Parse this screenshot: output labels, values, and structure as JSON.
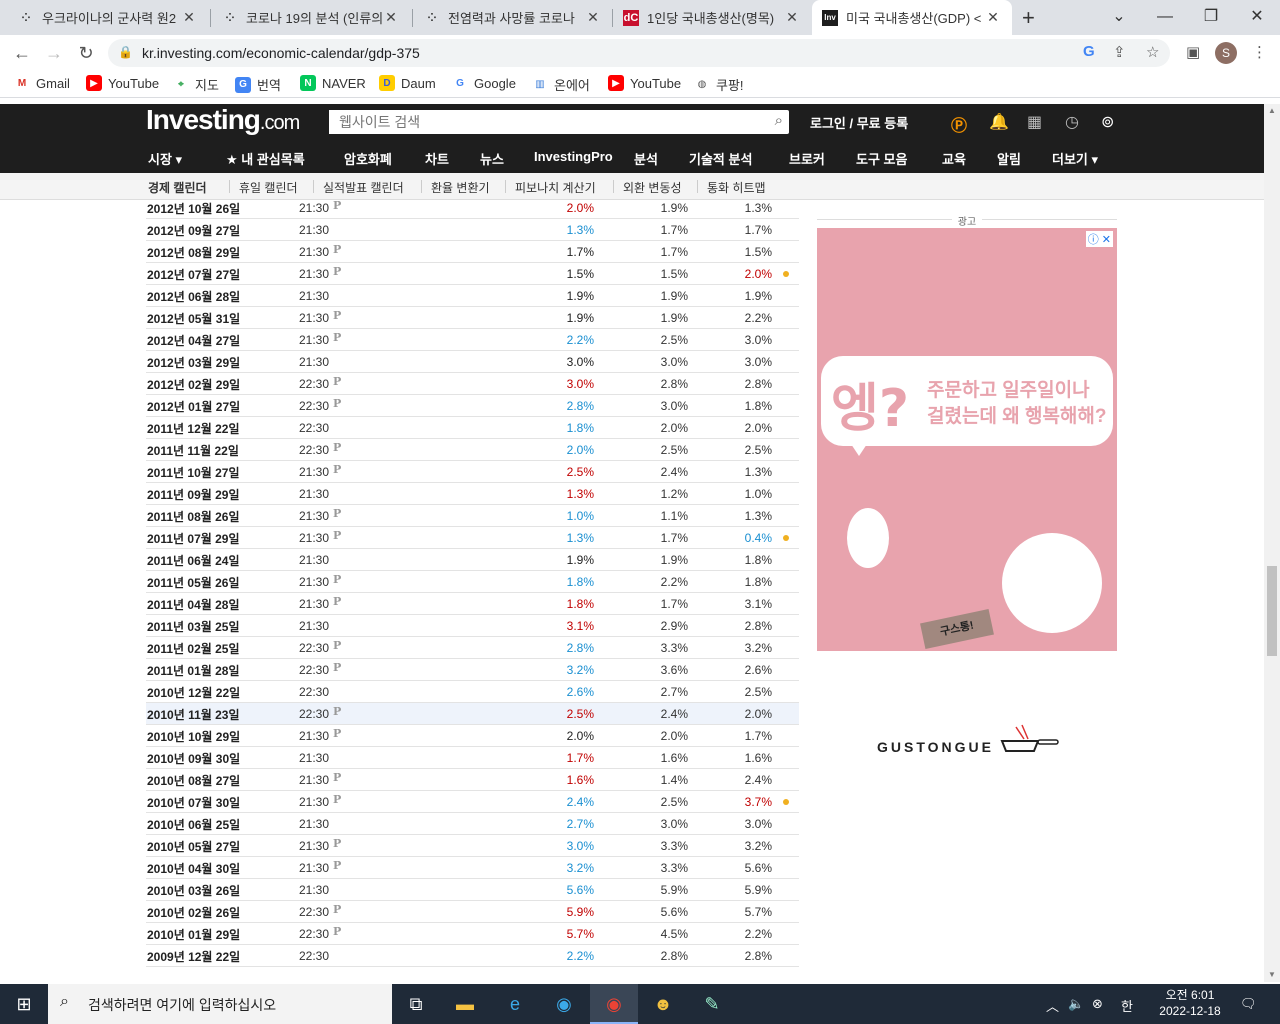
{
  "browser": {
    "tabs": [
      {
        "title": "우크라이나의 군사력 원2",
        "icon": "dots-icon"
      },
      {
        "title": "코로나 19의 분석 (인류의",
        "icon": "dots-icon"
      },
      {
        "title": "전염력과 사망률 코로나",
        "icon": "dots-icon"
      },
      {
        "title": "1인당 국내총생산(명목)",
        "icon": "dc-icon",
        "icon_text": "dC"
      },
      {
        "title": "미국 국내총생산(GDP) <",
        "icon": "inv-icon",
        "icon_text": "Inv",
        "active": true
      }
    ],
    "url": "kr.investing.com/economic-calendar/gdp-375",
    "profile_initial": "S"
  },
  "bookmarks": [
    {
      "label": "Gmail",
      "icon": "gmail-icon"
    },
    {
      "label": "YouTube",
      "icon": "youtube-icon"
    },
    {
      "label": "지도",
      "icon": "maps-icon"
    },
    {
      "label": "번역",
      "icon": "translate-icon"
    },
    {
      "label": "NAVER",
      "icon": "naver-icon",
      "icon_text": "N"
    },
    {
      "label": "Daum",
      "icon": "daum-icon",
      "icon_text": "D"
    },
    {
      "label": "Google",
      "icon": "google-icon",
      "icon_text": "G"
    },
    {
      "label": "온에어",
      "icon": "onair-icon"
    },
    {
      "label": "YouTube",
      "icon": "youtube-icon"
    },
    {
      "label": "쿠팡!",
      "icon": "globe-icon"
    }
  ],
  "site": {
    "logo": "Investing",
    "logo_domain": ".com",
    "search_placeholder": "웹사이트 검색",
    "login": "로그인 / 무료 등록",
    "nav": [
      "시장 ▾",
      "★ 내 관심목록",
      "암호화폐",
      "차트",
      "뉴스",
      "InvestingPro",
      "분석",
      "기술적 분석",
      "브로커",
      "도구 모음",
      "교육",
      "알림",
      "더보기 ▾"
    ],
    "subnav": [
      "경제 캘린더",
      "휴일 캘린더",
      "실적발표 캘린더",
      "환율 변환기",
      "피보나치 계산기",
      "외환 변동성",
      "통화 히트맵"
    ]
  },
  "colors": {
    "up": "#0ea600",
    "down": "#c00",
    "neutral": "#222",
    "blue": "#1a8fd1",
    "red": "#c00000",
    "accent": "#f0b020"
  },
  "table": {
    "rows": [
      {
        "date": "2012년 10월 26일",
        "time": "21:30",
        "p": true,
        "actual": "2.0%",
        "actual_color": "red",
        "forecast": "1.9%",
        "previous": "1.3%"
      },
      {
        "date": "2012년 09월 27일",
        "time": "21:30",
        "p": false,
        "actual": "1.3%",
        "actual_color": "blue",
        "forecast": "1.7%",
        "previous": "1.7%"
      },
      {
        "date": "2012년 08월 29일",
        "time": "21:30",
        "p": true,
        "actual": "1.7%",
        "actual_color": "neutral",
        "forecast": "1.7%",
        "previous": "1.5%"
      },
      {
        "date": "2012년 07월 27일",
        "time": "21:30",
        "p": true,
        "actual": "1.5%",
        "actual_color": "neutral",
        "forecast": "1.5%",
        "previous": "2.0%",
        "previous_color": "red",
        "dot": true
      },
      {
        "date": "2012년 06월 28일",
        "time": "21:30",
        "p": false,
        "actual": "1.9%",
        "actual_color": "neutral",
        "forecast": "1.9%",
        "previous": "1.9%"
      },
      {
        "date": "2012년 05월 31일",
        "time": "21:30",
        "p": true,
        "actual": "1.9%",
        "actual_color": "neutral",
        "forecast": "1.9%",
        "previous": "2.2%"
      },
      {
        "date": "2012년 04월 27일",
        "time": "21:30",
        "p": true,
        "actual": "2.2%",
        "actual_color": "blue",
        "forecast": "2.5%",
        "previous": "3.0%"
      },
      {
        "date": "2012년 03월 29일",
        "time": "21:30",
        "p": false,
        "actual": "3.0%",
        "actual_color": "neutral",
        "forecast": "3.0%",
        "previous": "3.0%"
      },
      {
        "date": "2012년 02월 29일",
        "time": "22:30",
        "p": true,
        "actual": "3.0%",
        "actual_color": "red",
        "forecast": "2.8%",
        "previous": "2.8%"
      },
      {
        "date": "2012년 01월 27일",
        "time": "22:30",
        "p": true,
        "actual": "2.8%",
        "actual_color": "blue",
        "forecast": "3.0%",
        "previous": "1.8%"
      },
      {
        "date": "2011년 12월 22일",
        "time": "22:30",
        "p": false,
        "actual": "1.8%",
        "actual_color": "blue",
        "forecast": "2.0%",
        "previous": "2.0%"
      },
      {
        "date": "2011년 11월 22일",
        "time": "22:30",
        "p": true,
        "actual": "2.0%",
        "actual_color": "blue",
        "forecast": "2.5%",
        "previous": "2.5%"
      },
      {
        "date": "2011년 10월 27일",
        "time": "21:30",
        "p": true,
        "actual": "2.5%",
        "actual_color": "red",
        "forecast": "2.4%",
        "previous": "1.3%"
      },
      {
        "date": "2011년 09월 29일",
        "time": "21:30",
        "p": false,
        "actual": "1.3%",
        "actual_color": "red",
        "forecast": "1.2%",
        "previous": "1.0%"
      },
      {
        "date": "2011년 08월 26일",
        "time": "21:30",
        "p": true,
        "actual": "1.0%",
        "actual_color": "blue",
        "forecast": "1.1%",
        "previous": "1.3%"
      },
      {
        "date": "2011년 07월 29일",
        "time": "21:30",
        "p": true,
        "actual": "1.3%",
        "actual_color": "blue",
        "forecast": "1.7%",
        "previous": "0.4%",
        "previous_color": "blue",
        "dot": true
      },
      {
        "date": "2011년 06월 24일",
        "time": "21:30",
        "p": false,
        "actual": "1.9%",
        "actual_color": "neutral",
        "forecast": "1.9%",
        "previous": "1.8%"
      },
      {
        "date": "2011년 05월 26일",
        "time": "21:30",
        "p": true,
        "actual": "1.8%",
        "actual_color": "blue",
        "forecast": "2.2%",
        "previous": "1.8%"
      },
      {
        "date": "2011년 04월 28일",
        "time": "21:30",
        "p": true,
        "actual": "1.8%",
        "actual_color": "red",
        "forecast": "1.7%",
        "previous": "3.1%"
      },
      {
        "date": "2011년 03월 25일",
        "time": "21:30",
        "p": false,
        "actual": "3.1%",
        "actual_color": "red",
        "forecast": "2.9%",
        "previous": "2.8%"
      },
      {
        "date": "2011년 02월 25일",
        "time": "22:30",
        "p": true,
        "actual": "2.8%",
        "actual_color": "blue",
        "forecast": "3.3%",
        "previous": "3.2%"
      },
      {
        "date": "2011년 01월 28일",
        "time": "22:30",
        "p": true,
        "actual": "3.2%",
        "actual_color": "blue",
        "forecast": "3.6%",
        "previous": "2.6%"
      },
      {
        "date": "2010년 12월 22일",
        "time": "22:30",
        "p": false,
        "actual": "2.6%",
        "actual_color": "blue",
        "forecast": "2.7%",
        "previous": "2.5%"
      },
      {
        "date": "2010년 11월 23일",
        "time": "22:30",
        "p": true,
        "actual": "2.5%",
        "actual_color": "red",
        "forecast": "2.4%",
        "previous": "2.0%",
        "highlight": true
      },
      {
        "date": "2010년 10월 29일",
        "time": "21:30",
        "p": true,
        "actual": "2.0%",
        "actual_color": "neutral",
        "forecast": "2.0%",
        "previous": "1.7%"
      },
      {
        "date": "2010년 09월 30일",
        "time": "21:30",
        "p": false,
        "actual": "1.7%",
        "actual_color": "red",
        "forecast": "1.6%",
        "previous": "1.6%"
      },
      {
        "date": "2010년 08월 27일",
        "time": "21:30",
        "p": true,
        "actual": "1.6%",
        "actual_color": "red",
        "forecast": "1.4%",
        "previous": "2.4%"
      },
      {
        "date": "2010년 07월 30일",
        "time": "21:30",
        "p": true,
        "actual": "2.4%",
        "actual_color": "blue",
        "forecast": "2.5%",
        "previous": "3.7%",
        "previous_color": "red",
        "dot": true
      },
      {
        "date": "2010년 06월 25일",
        "time": "21:30",
        "p": false,
        "actual": "2.7%",
        "actual_color": "blue",
        "forecast": "3.0%",
        "previous": "3.0%"
      },
      {
        "date": "2010년 05월 27일",
        "time": "21:30",
        "p": true,
        "actual": "3.0%",
        "actual_color": "blue",
        "forecast": "3.3%",
        "previous": "3.2%"
      },
      {
        "date": "2010년 04월 30일",
        "time": "21:30",
        "p": true,
        "actual": "3.2%",
        "actual_color": "blue",
        "forecast": "3.3%",
        "previous": "5.6%"
      },
      {
        "date": "2010년 03월 26일",
        "time": "21:30",
        "p": false,
        "actual": "5.6%",
        "actual_color": "blue",
        "forecast": "5.9%",
        "previous": "5.9%"
      },
      {
        "date": "2010년 02월 26일",
        "time": "22:30",
        "p": true,
        "actual": "5.9%",
        "actual_color": "red",
        "forecast": "5.6%",
        "previous": "5.7%"
      },
      {
        "date": "2010년 01월 29일",
        "time": "22:30",
        "p": true,
        "actual": "5.7%",
        "actual_color": "red",
        "forecast": "4.5%",
        "previous": "2.2%"
      },
      {
        "date": "2009년 12월 22일",
        "time": "22:30",
        "p": false,
        "actual": "2.2%",
        "actual_color": "blue",
        "forecast": "2.8%",
        "previous": "2.8%"
      }
    ],
    "preliminary_mark": "P"
  },
  "ad": {
    "label": "광고",
    "headline_big": "엥?",
    "headline_text": [
      "주문하고 일주일이나",
      "걸렸는데 왜 행복해해?"
    ],
    "box_text": "구스통!",
    "brand": "GUSTONGUE",
    "ad_controls": "ⓘ ✕"
  },
  "taskbar": {
    "search_placeholder": "검색하려면 여기에 입력하십시오",
    "time": "오전 6:01",
    "date": "2022-12-18",
    "ime": "한"
  }
}
